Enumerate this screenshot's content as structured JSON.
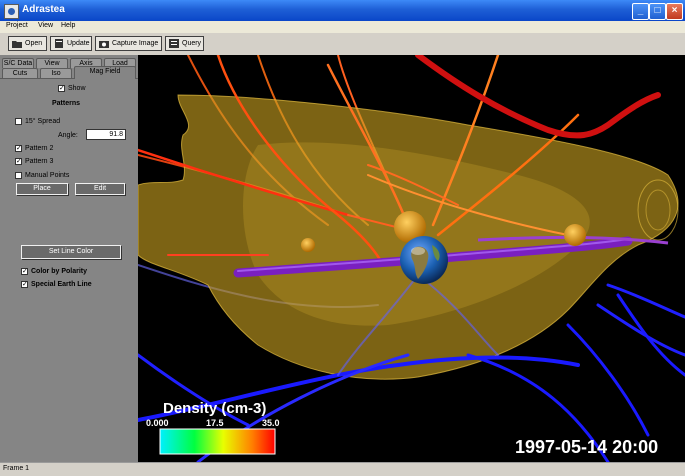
{
  "window": {
    "title": "Adrastea"
  },
  "menu": {
    "items": [
      "Project",
      "View",
      "Help"
    ]
  },
  "toolbar": {
    "open": "Open",
    "update": "Update",
    "capture": "Capture Image",
    "query": "Query"
  },
  "tabs": {
    "row1": [
      "S/C Data",
      "View",
      "Axis",
      "Load"
    ],
    "row2": [
      "Cuts",
      "Iso",
      "Mag Field"
    ],
    "active": "Mag Field"
  },
  "magfield": {
    "show_label": "Show",
    "show_checked": true,
    "patterns_heading": "Patterns",
    "spread_label": "15° Spread",
    "spread_checked": false,
    "angle_label": "Angle:",
    "angle_value": "91.8",
    "pattern2_label": "Pattern 2",
    "pattern2_checked": true,
    "pattern3_label": "Pattern 3",
    "pattern3_checked": true,
    "manual_label": "Manual Points",
    "manual_checked": false,
    "place_label": "Place",
    "edit_label": "Edit",
    "set_line_color_label": "Set Line Color",
    "color_by_polarity_label": "Color by Polarity",
    "color_by_polarity_checked": true,
    "special_earth_line_label": "Special Earth Line",
    "special_earth_line_checked": true
  },
  "colorbar": {
    "title": "Density (cm-3)",
    "min": "0.000",
    "mid": "17.5",
    "max": "35.0"
  },
  "timestamp": "1997-05-14  20:00",
  "status": {
    "text": "Frame 1"
  },
  "colors": {
    "titlebar": "#1e5fd6",
    "panel": "#858585",
    "viewport_bg": "#000000",
    "iso_surface": "#c8a020",
    "field_line_north": "#ff3010",
    "field_line_south": "#1a1aff",
    "earth_line": "#7a1fc0"
  }
}
